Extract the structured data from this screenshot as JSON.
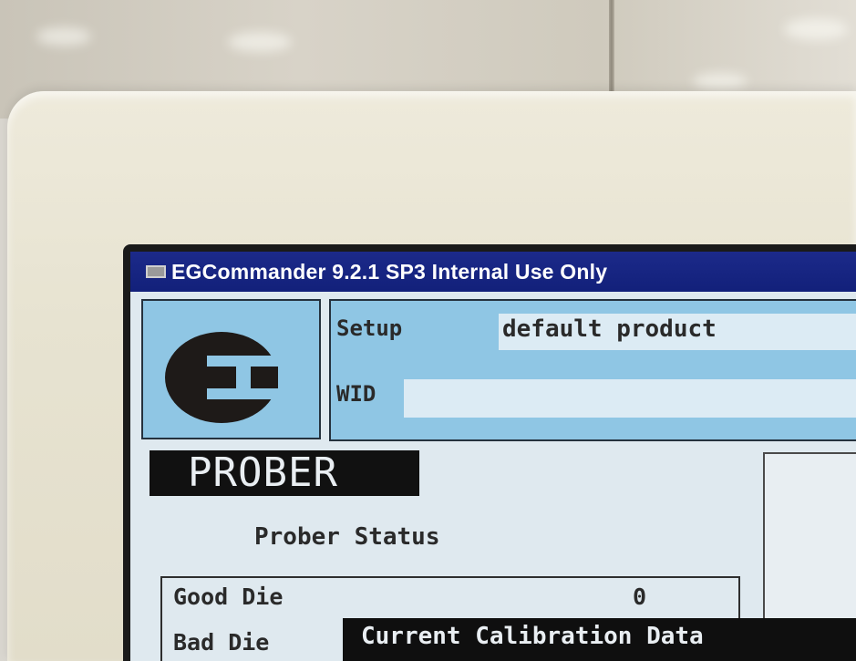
{
  "window": {
    "title": "EGCommander 9.2.1 SP3 Internal Use Only"
  },
  "header": {
    "logo_icon": "eg-logo-icon",
    "setup_label": "Setup",
    "setup_value": "default product",
    "wid_label": "WID",
    "wid_value": ""
  },
  "main": {
    "banner": "PROBER",
    "status_heading": "Prober Status",
    "rows": [
      {
        "label": "Good Die",
        "value": "0"
      },
      {
        "label": "Bad Die",
        "value": ""
      }
    ],
    "calibration_title": "Current Calibration Data"
  },
  "colors": {
    "titlebar": "#12207a",
    "panel": "#8fc6e4",
    "screen": "#dfe9ef",
    "banner": "#111111"
  }
}
